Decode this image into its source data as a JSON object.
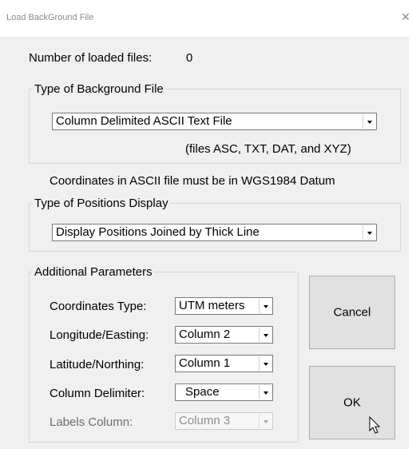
{
  "window": {
    "title": "Load BackGround File",
    "close_glyph": "✕"
  },
  "info": {
    "loaded_label": "Number of loaded files:",
    "loaded_count": "0",
    "datum_note": "Coordinates in ASCII file must be in WGS1984 Datum"
  },
  "background_file": {
    "legend": "Type of Background File",
    "selected": "Column Delimited ASCII Text File",
    "hint": "(files ASC, TXT, DAT, and XYZ)"
  },
  "positions_display": {
    "legend": "Type of Positions Display",
    "selected": "Display Positions Joined by Thick Line"
  },
  "additional": {
    "legend": "Additional Parameters",
    "coordinates_type": {
      "label": "Coordinates Type:",
      "value": "UTM meters"
    },
    "longitude": {
      "label": "Longitude/Easting:",
      "value": "Column 2"
    },
    "latitude": {
      "label": "Latitude/Northing:",
      "value": "Column 1"
    },
    "delimiter": {
      "label": "Column Delimiter:",
      "value": "Space"
    },
    "labels_column": {
      "label": "Labels Column:",
      "value": "Column 3",
      "enabled": false
    }
  },
  "buttons": {
    "cancel": "Cancel",
    "ok": "OK"
  },
  "icons": {
    "close": "close-icon",
    "dropdown": "chevron-down-icon",
    "cursor": "mouse-pointer-icon"
  }
}
